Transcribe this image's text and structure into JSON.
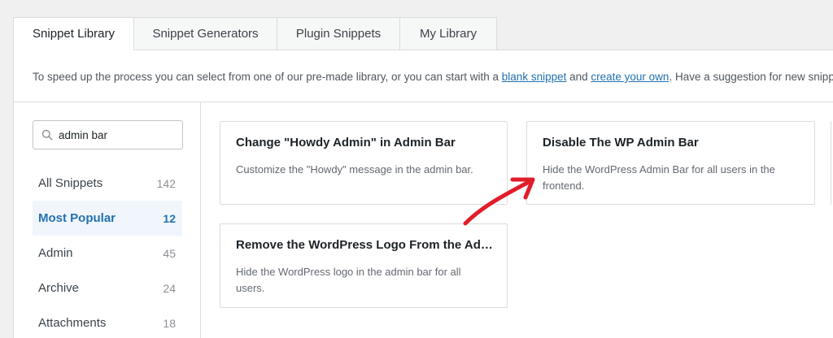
{
  "tabs": [
    {
      "label": "Snippet Library",
      "active": true
    },
    {
      "label": "Snippet Generators",
      "active": false
    },
    {
      "label": "Plugin Snippets",
      "active": false
    },
    {
      "label": "My Library",
      "active": false
    }
  ],
  "intro": {
    "text_before": "To speed up the process you can select from one of our pre-made library, or you can start with a ",
    "link_blank": "blank snippet",
    "text_and": " and ",
    "link_create": "create your own",
    "text_after": ". Have a suggestion for new snippet?"
  },
  "search": {
    "value": "admin bar",
    "icon": "search-icon"
  },
  "categories": [
    {
      "label": "All Snippets",
      "count": "142",
      "active": false
    },
    {
      "label": "Most Popular",
      "count": "12",
      "active": true
    },
    {
      "label": "Admin",
      "count": "45",
      "active": false
    },
    {
      "label": "Archive",
      "count": "24",
      "active": false
    },
    {
      "label": "Attachments",
      "count": "18",
      "active": false
    }
  ],
  "cards": [
    {
      "title": "Change \"Howdy Admin\" in Admin Bar",
      "description": "Customize the \"Howdy\" message in the admin bar."
    },
    {
      "title": "Disable The WP Admin Bar",
      "description": "Hide the WordPress Admin Bar for all users in the frontend."
    },
    {
      "title": "Remove the WordPress Logo From the Admin Bar",
      "description": "Hide the WordPress logo in the admin bar for all users."
    }
  ],
  "colors": {
    "accent": "#2271b1",
    "active_bg": "#f0f6fc",
    "annotation_arrow": "#e11d2a"
  }
}
